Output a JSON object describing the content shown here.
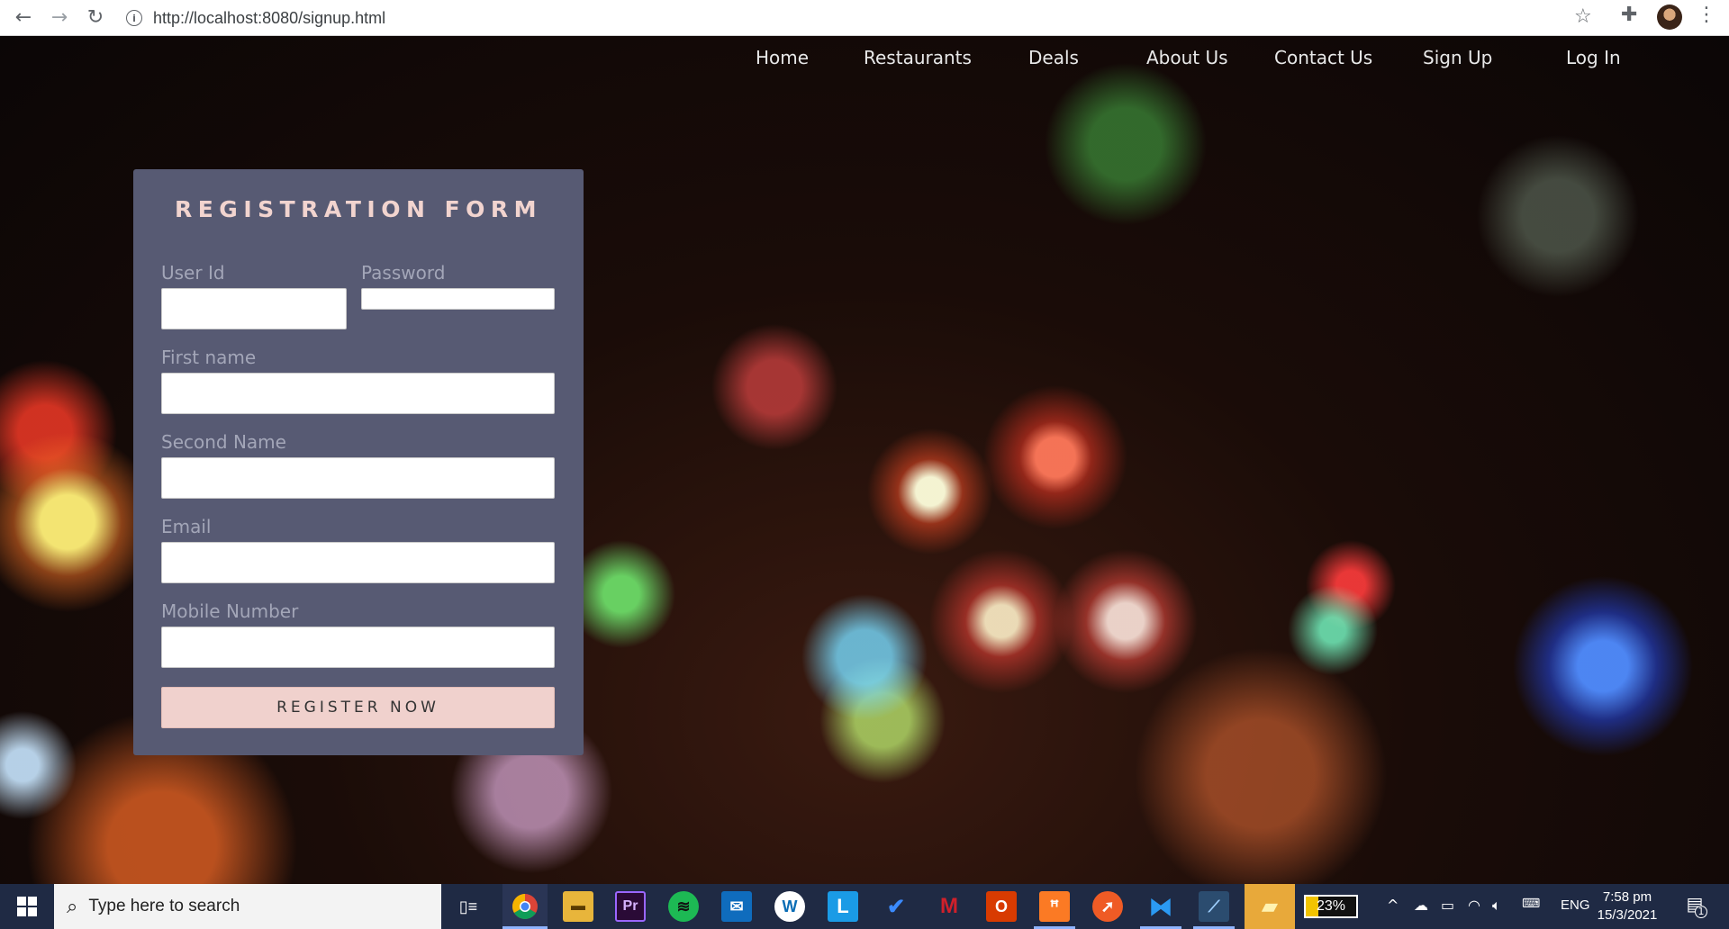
{
  "browser": {
    "url": "http://localhost:8080/signup.html",
    "back_icon": "arrow-left-icon",
    "forward_icon": "arrow-right-icon",
    "reload_icon": "reload-icon",
    "info_icon": "info-icon",
    "bookmark_icon": "star-icon",
    "extensions_icon": "puzzle-icon",
    "menu_icon": "kebab-menu-icon"
  },
  "nav": {
    "items": [
      "Home",
      "Restaurants",
      "Deals",
      "About Us",
      "Contact Us",
      "Sign Up",
      "Log In"
    ]
  },
  "form": {
    "title": "REGISTRATION FORM",
    "user_id_label": "User Id",
    "password_label": "Password",
    "first_name_label": "First name",
    "second_name_label": "Second Name",
    "email_label": "Email",
    "mobile_label": "Mobile Number",
    "user_id_value": "",
    "password_value": "",
    "first_name_value": "",
    "second_name_value": "",
    "email_value": "",
    "mobile_value": "",
    "submit_label": "REGISTER NOW"
  },
  "taskbar": {
    "search_placeholder": "Type here to search",
    "battery_percent": "23%",
    "language": "ENG",
    "time": "7:58 pm",
    "date": "15/3/2021",
    "notification_count": "1",
    "apps": [
      "task-view",
      "chrome",
      "file-explorer",
      "premiere-pro",
      "spotify",
      "mail",
      "wordpress",
      "l-app",
      "todo",
      "mcafee",
      "office",
      "xampp",
      "postman",
      "vscode",
      "mysql-workbench",
      "sticky-notes"
    ]
  },
  "colors": {
    "form_bg": "#575a73",
    "title": "#f2d4cf",
    "button_bg": "#f0d1cd",
    "taskbar": "#1f2a44"
  }
}
